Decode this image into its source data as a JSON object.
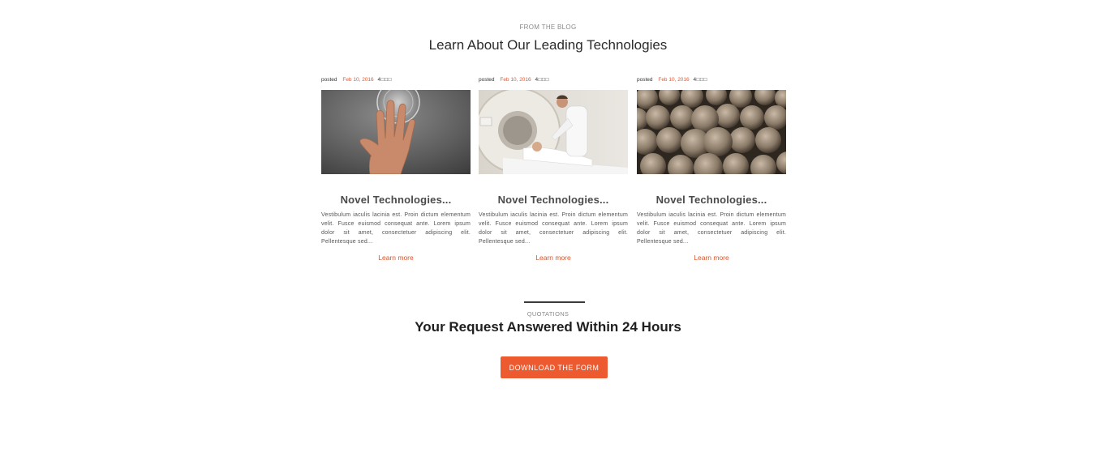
{
  "blog": {
    "eyebrow": "FROM THE BLOG",
    "title": "Learn About Our Leading Technologies"
  },
  "posts": [
    {
      "posted_label": "posted",
      "date": "Feb 10, 2016",
      "comments": "4",
      "comment_icon_text": "□□□",
      "image": "hand-touch-screen",
      "title": "Novel Technologies...",
      "excerpt": "Vestibulum iaculis lacinia est. Proin dictum elementum velit. Fusce euismod consequat ante. Lorem ipsum dolor sit amet, consectetuer adipiscing elit. Pellentesque sed...",
      "link": "Learn more"
    },
    {
      "posted_label": "posted",
      "date": "Feb 10, 2016",
      "comments": "4",
      "comment_icon_text": "□□□",
      "image": "mri-scanner-doctor",
      "title": "Novel Technologies...",
      "excerpt": "Vestibulum iaculis lacinia est. Proin dictum elementum velit. Fusce euismod consequat ante. Lorem ipsum dolor sit amet, consectetuer adipiscing elit. Pellentesque sed...",
      "link": "Learn more"
    },
    {
      "posted_label": "posted",
      "date": "Feb 10, 2016",
      "comments": "4",
      "comment_icon_text": "□□□",
      "image": "cells-microscopy",
      "title": "Novel Technologies...",
      "excerpt": "Vestibulum iaculis lacinia est. Proin dictum elementum velit. Fusce euismod consequat ante. Lorem ipsum dolor sit amet, consectetuer adipiscing elit. Pellentesque sed...",
      "link": "Learn more"
    }
  ],
  "quotations": {
    "eyebrow": "QUOTATIONS",
    "title": "Your Request Answered Within 24 Hours",
    "button_label": "DOWNLOAD THE FORM"
  },
  "colors": {
    "accent": "#ee5a2f",
    "date": "#e8552c",
    "link": "#d8542a"
  }
}
